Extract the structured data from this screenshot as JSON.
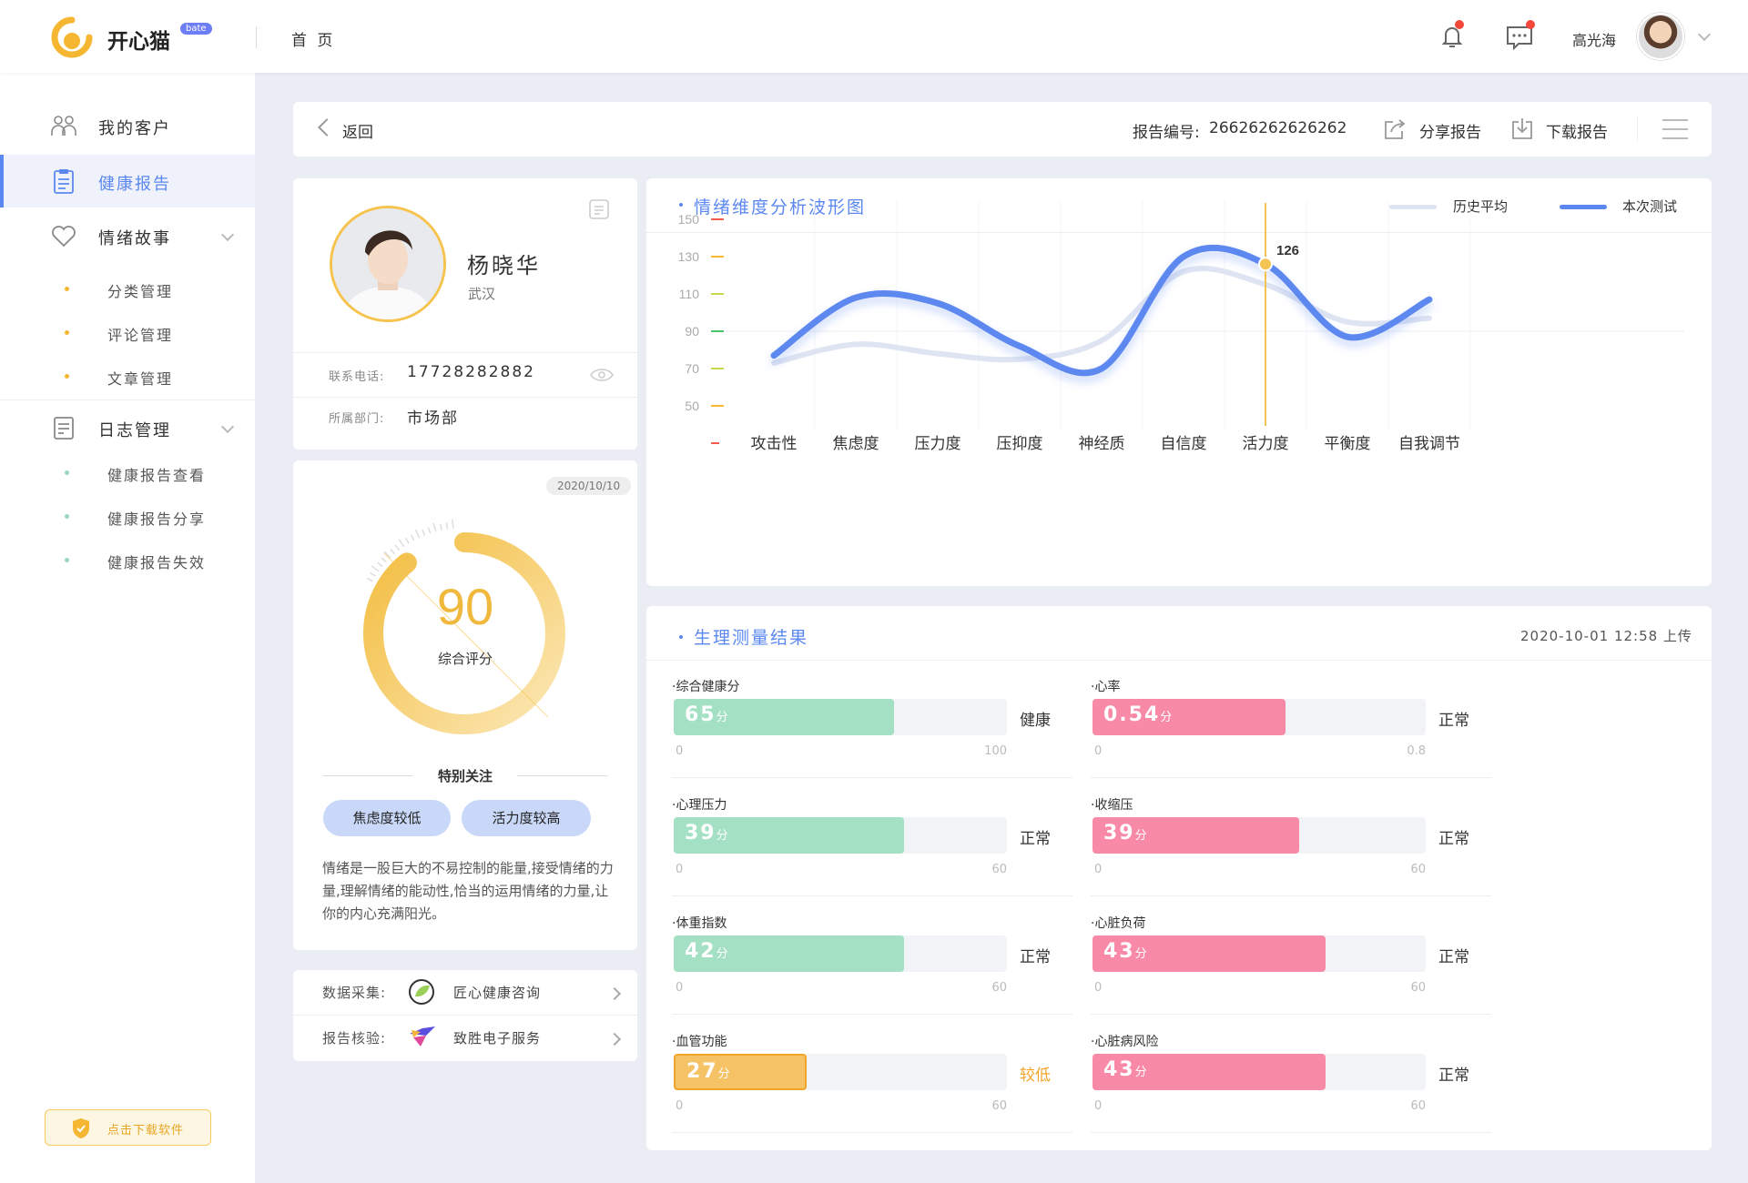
{
  "app": {
    "name": "开心猫",
    "badge": "bate",
    "home": "首 页",
    "username": "高光海"
  },
  "colors": {
    "accent": "#5b88f0",
    "gauge": "#f0b93d",
    "green": "#a4e0c3",
    "pink": "#f98aa7",
    "orange": "#f5c266"
  },
  "sidebar": {
    "items": [
      {
        "label": "我的客户",
        "icon": "users-icon"
      },
      {
        "label": "健康报告",
        "icon": "clipboard-icon",
        "active": true
      },
      {
        "label": "情绪故事",
        "icon": "heart-icon"
      },
      {
        "label": "日志管理",
        "icon": "log-icon"
      }
    ],
    "story_sub": [
      "分类管理",
      "评论管理",
      "文章管理"
    ],
    "log_sub": [
      "健康报告查看",
      "健康报告分享",
      "健康报告失效"
    ],
    "download": "点击下载软件"
  },
  "toolbar": {
    "back": "返回",
    "report_no_label": "报告编号:",
    "report_no": "26626262626262",
    "share": "分享报告",
    "download": "下载报告"
  },
  "profile": {
    "name": "杨晓华",
    "city": "武汉",
    "phone_label": "联系电话:",
    "phone": "17728282882",
    "dept_label": "所属部门:",
    "dept": "市场部"
  },
  "score": {
    "date": "2020/10/10",
    "value": 90,
    "max": 100,
    "label": "综合评分",
    "focus_title": "特别关注",
    "tags": [
      "焦虑度较低",
      "活力度较高"
    ],
    "desc": "情绪是一股巨大的不易控制的能量,接受情绪的力量,理解情绪的能动性,恰当的运用情绪的力量,让你的内心充满阳光。"
  },
  "source": {
    "collect_label": "数据采集:",
    "collect": "匠心健康咨询",
    "verify_label": "报告核验:",
    "verify": "致胜电子服务"
  },
  "chart_data": {
    "type": "line",
    "title": "情绪维度分析波形图",
    "categories": [
      "攻击性",
      "焦虑度",
      "压力度",
      "压抑度",
      "神经质",
      "自信度",
      "活力度",
      "平衡度",
      "自我调节"
    ],
    "yticks": [
      150,
      130,
      110,
      90,
      70,
      50
    ],
    "ylim": [
      50,
      150
    ],
    "series": [
      {
        "name": "历史平均",
        "values": [
          73,
          83,
          78,
          75,
          85,
          122,
          115,
          95,
          97
        ]
      },
      {
        "name": "本次测试",
        "values": [
          77,
          108,
          105,
          82,
          70,
          130,
          126,
          87,
          107
        ]
      }
    ],
    "highlight": {
      "category": "活力度",
      "value": "126"
    },
    "legend": "top-right"
  },
  "physio": {
    "title": "生理测量结果",
    "upload": "2020-10-01 12:58  上传",
    "metrics": [
      {
        "name": "综合健康分",
        "value": "65",
        "unit": "分",
        "fraction": 0.66,
        "status": "健康",
        "min": "0",
        "max": "100",
        "color": "green"
      },
      {
        "name": "心率",
        "value": "0.54",
        "unit": "分",
        "fraction": 0.58,
        "status": "正常",
        "min": "0",
        "max": "0.8",
        "color": "pink"
      },
      {
        "name": "心理压力",
        "value": "39",
        "unit": "分",
        "fraction": 0.69,
        "status": "正常",
        "min": "0",
        "max": "60",
        "color": "green"
      },
      {
        "name": "收缩压",
        "value": "39",
        "unit": "分",
        "fraction": 0.62,
        "status": "正常",
        "min": "0",
        "max": "60",
        "color": "pink"
      },
      {
        "name": "体重指数",
        "value": "42",
        "unit": "分",
        "fraction": 0.69,
        "status": "正常",
        "min": "0",
        "max": "60",
        "color": "green"
      },
      {
        "name": "心脏负荷",
        "value": "43",
        "unit": "分",
        "fraction": 0.7,
        "status": "正常",
        "min": "0",
        "max": "60",
        "color": "pink"
      },
      {
        "name": "血管功能",
        "value": "27",
        "unit": "分",
        "fraction": 0.4,
        "status": "较低",
        "min": "0",
        "max": "60",
        "color": "orange"
      },
      {
        "name": "心脏病风险",
        "value": "43",
        "unit": "分",
        "fraction": 0.7,
        "status": "正常",
        "min": "0",
        "max": "60",
        "color": "pink"
      }
    ]
  }
}
